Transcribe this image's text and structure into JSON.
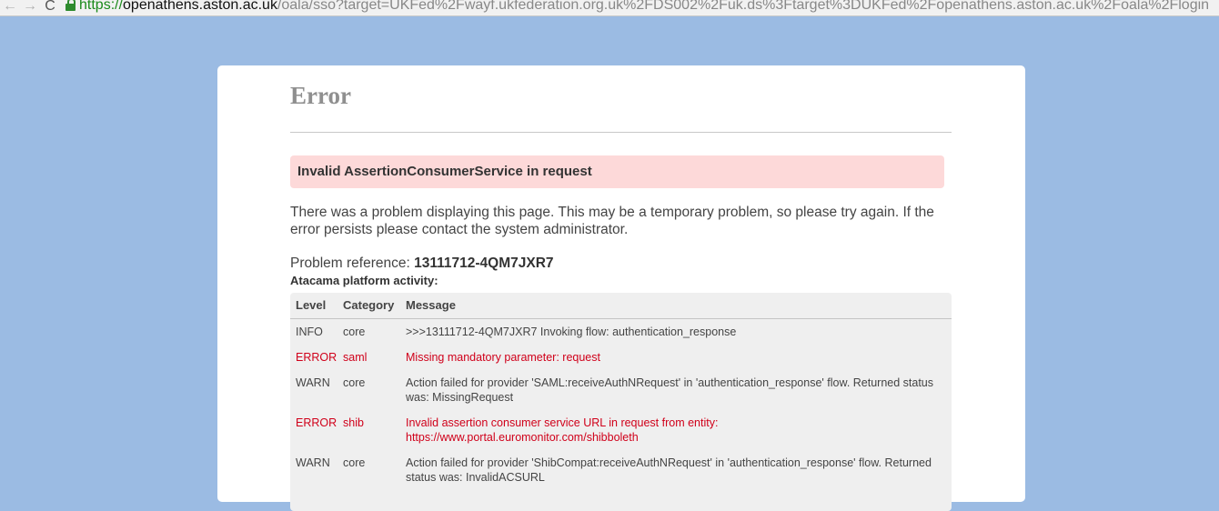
{
  "browser": {
    "back_icon": "←",
    "forward_icon": "→",
    "reload_icon": "C",
    "url_scheme": "https://",
    "url_host": "openathens.aston.ac.uk",
    "url_rest": "/oala/sso?target=UKFed%2Fwayf.ukfederation.org.uk%2FDS002%2Fuk.ds%3Ftarget%3DUKFed%2Fopenathens.aston.ac.uk%2Foala%2Flogin"
  },
  "page": {
    "title": "Error",
    "alert": "Invalid AssertionConsumerService in request",
    "description": "There was a problem displaying this page. This may be a temporary problem, so please try again. If the error persists please contact the system administrator.",
    "ref_label": "Problem reference: ",
    "ref_value": "13111712-4QM7JXR7",
    "activity_title": "Atacama platform activity:"
  },
  "log": {
    "headers": {
      "level": "Level",
      "category": "Category",
      "message": "Message"
    },
    "rows": [
      {
        "level": "INFO",
        "category": "core",
        "message": ">>>13111712-4QM7JXR7 Invoking flow: authentication_response"
      },
      {
        "level": "ERROR",
        "category": "saml",
        "message": "Missing mandatory parameter: request"
      },
      {
        "level": "WARN",
        "category": "core",
        "message": "Action failed for provider 'SAML:receiveAuthNRequest' in 'authentication_response' flow. Returned status was: MissingRequest"
      },
      {
        "level": "ERROR",
        "category": "shib",
        "message": "Invalid assertion consumer service URL in request from entity: https://www.portal.euromonitor.com/shibboleth"
      },
      {
        "level": "WARN",
        "category": "core",
        "message": "Action failed for provider 'ShibCompat:receiveAuthNRequest' in 'authentication_response' flow. Returned status was: InvalidACSURL"
      }
    ]
  },
  "colors": {
    "background": "#9bbbe3",
    "alert_bg": "#fdd9d9",
    "error_text": "#d0001a"
  }
}
